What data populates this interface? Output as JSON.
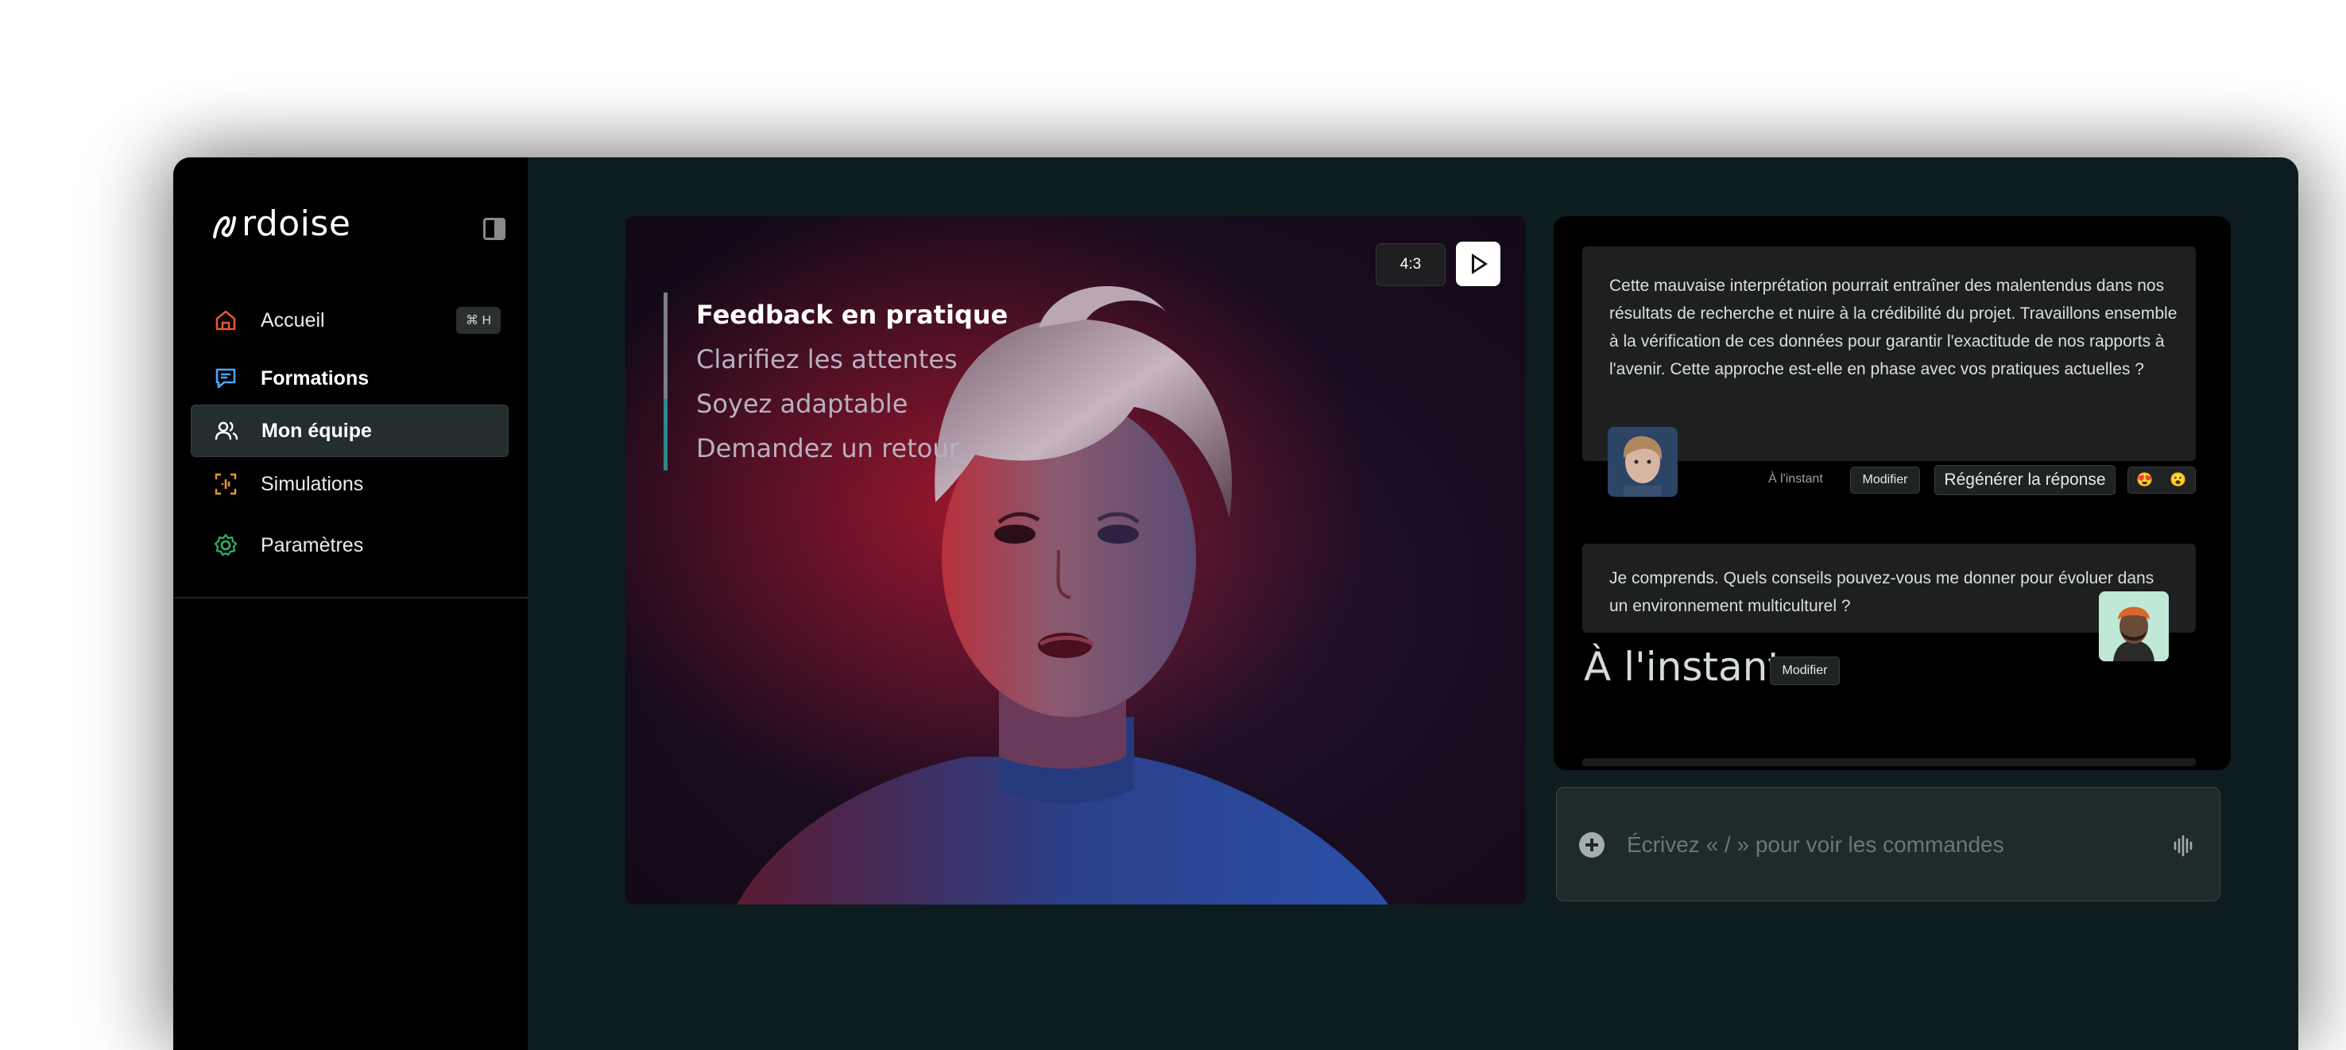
{
  "app": {
    "logo_text": "rdoise",
    "colors": {
      "background": "#0d1c1e",
      "sidebar": "#000000",
      "accent_orange": "#e35a2b",
      "accent_green": "#2bb36c"
    }
  },
  "sidebar": {
    "items": [
      {
        "label": "Accueil",
        "icon": "home-icon",
        "shortcut": "⌘ H"
      },
      {
        "label": "Formations",
        "icon": "chat-icon"
      },
      {
        "label": "Mon équipe",
        "icon": "users-icon",
        "active": true
      },
      {
        "label": "Simulations",
        "icon": "simulation-icon"
      },
      {
        "label": "Paramètres",
        "icon": "gear-icon"
      }
    ]
  },
  "video": {
    "agenda": [
      "Feedback en pratique",
      "Clarifiez les attentes",
      "Soyez adaptable",
      "Demandez un retour"
    ],
    "ratio_label": "4:3",
    "play_icon": "play-icon"
  },
  "chat": {
    "message_1": "Cette mauvaise interprétation pourrait entraîner des malentendus dans nos résultats de recherche et nuire à la crédibilité du projet. Travaillons ensemble à la vérification de ces données pour garantir l'exactitude de nos rapports à l'avenir. Cette approche est-elle en phase avec vos pratiques actuelles ?",
    "meta_time": "À l'instant",
    "modify_label": "Modifier",
    "regenerate_label": "Régénérer la réponse",
    "reactions": [
      "😍",
      "😮"
    ],
    "message_2": "Je comprends. Quels conseils pouvez-vous me donner pour évoluer dans un environnement multiculturel ?",
    "big_time": "À l'instant",
    "modify_label_2": "Modifier"
  },
  "composer": {
    "placeholder": "Écrivez « / » pour voir les commandes"
  }
}
